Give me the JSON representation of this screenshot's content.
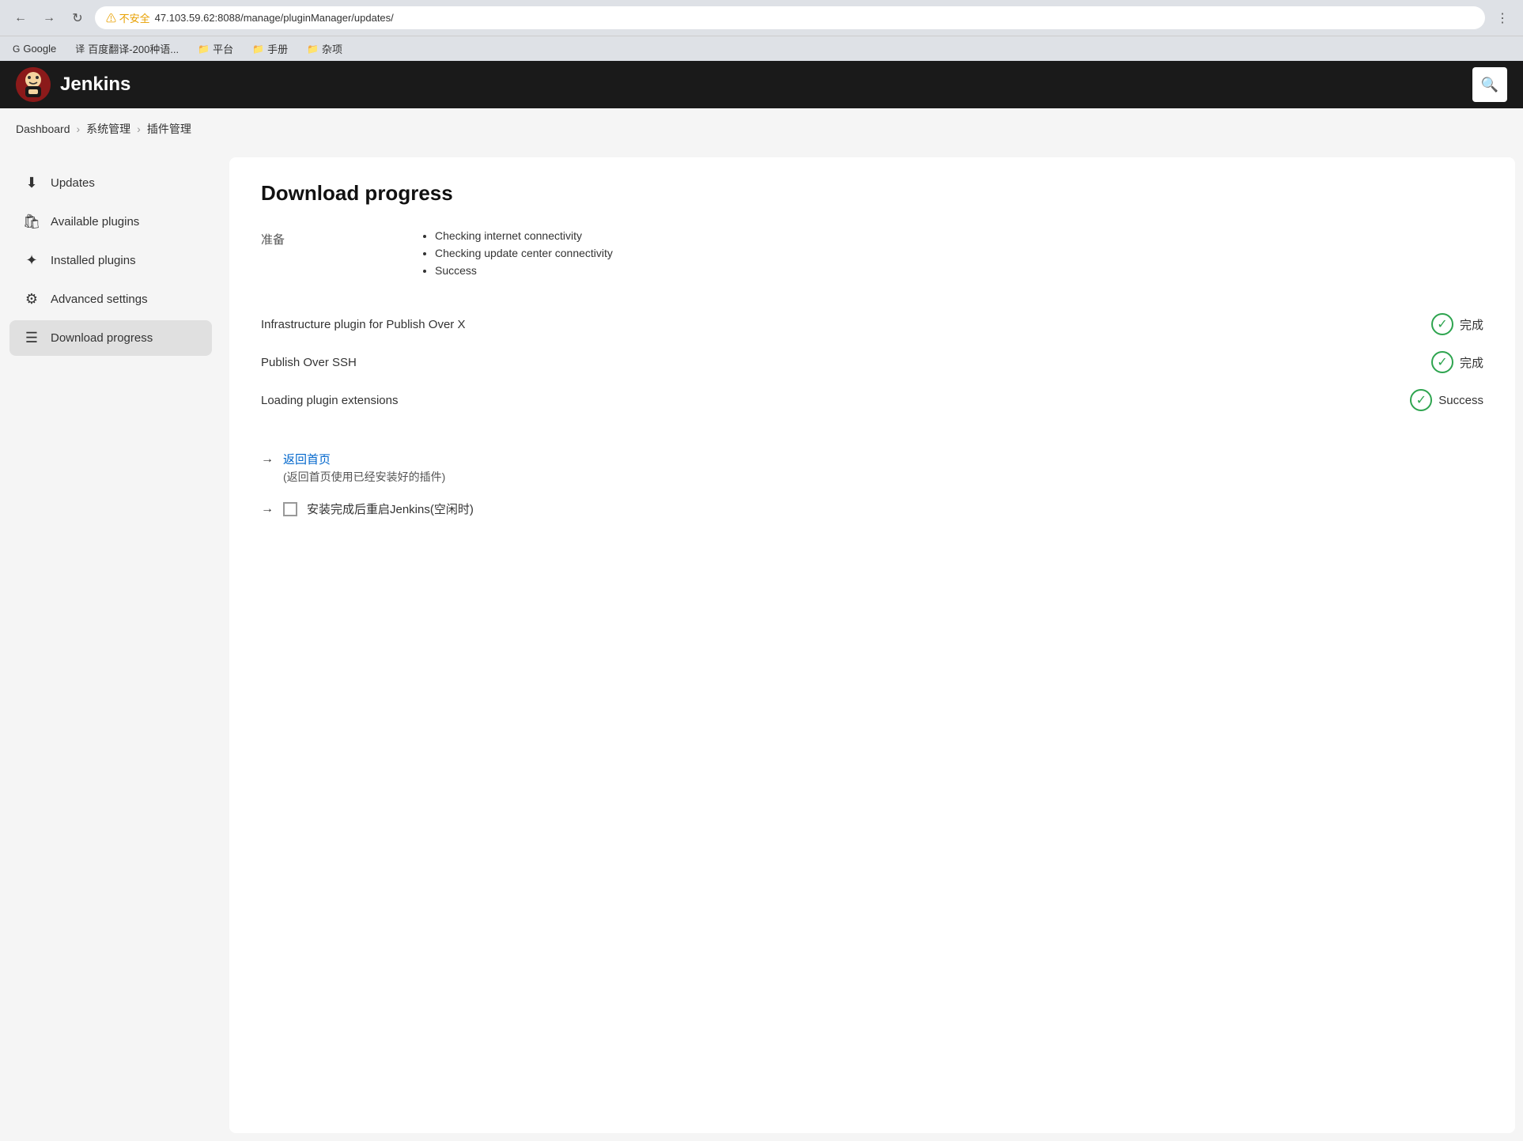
{
  "browser": {
    "url": "47.103.59.62:8088/manage/pluginManager/updates/",
    "warning_text": "不安全",
    "bookmarks": [
      {
        "icon": "G",
        "label": "Google"
      },
      {
        "icon": "译",
        "label": "百度翻译-200种语..."
      },
      {
        "icon": "📁",
        "label": "平台"
      },
      {
        "icon": "📁",
        "label": "手册"
      },
      {
        "icon": "📁",
        "label": "杂项"
      }
    ]
  },
  "header": {
    "title": "Jenkins",
    "search_placeholder": "Search"
  },
  "breadcrumb": {
    "items": [
      "Dashboard",
      "系统管理",
      "插件管理"
    ],
    "separators": [
      "›",
      "›"
    ]
  },
  "sidebar": {
    "items": [
      {
        "id": "updates",
        "icon": "⬇",
        "label": "Updates",
        "active": false
      },
      {
        "id": "available-plugins",
        "icon": "🛍",
        "label": "Available plugins",
        "active": false
      },
      {
        "id": "installed-plugins",
        "icon": "⚙",
        "label": "Installed plugins",
        "active": false
      },
      {
        "id": "advanced-settings",
        "icon": "⚙",
        "label": "Advanced settings",
        "active": false
      },
      {
        "id": "download-progress",
        "icon": "≡",
        "label": "Download progress",
        "active": true
      }
    ]
  },
  "main": {
    "title": "Download progress",
    "preparation": {
      "label": "准备",
      "checks": [
        "Checking internet connectivity",
        "Checking update center connectivity",
        "Success"
      ]
    },
    "plugins": [
      {
        "name": "Infrastructure plugin for Publish Over X",
        "status": "完成",
        "success": true
      },
      {
        "name": "Publish Over SSH",
        "status": "完成",
        "success": true
      },
      {
        "name": "Loading plugin extensions",
        "status": "Success",
        "success": true
      }
    ],
    "actions": {
      "return_link": "返回首页",
      "return_sub": "(返回首页使用已经安装好的插件)",
      "restart_label": "安装完成后重启Jenkins(空闲时)"
    }
  }
}
